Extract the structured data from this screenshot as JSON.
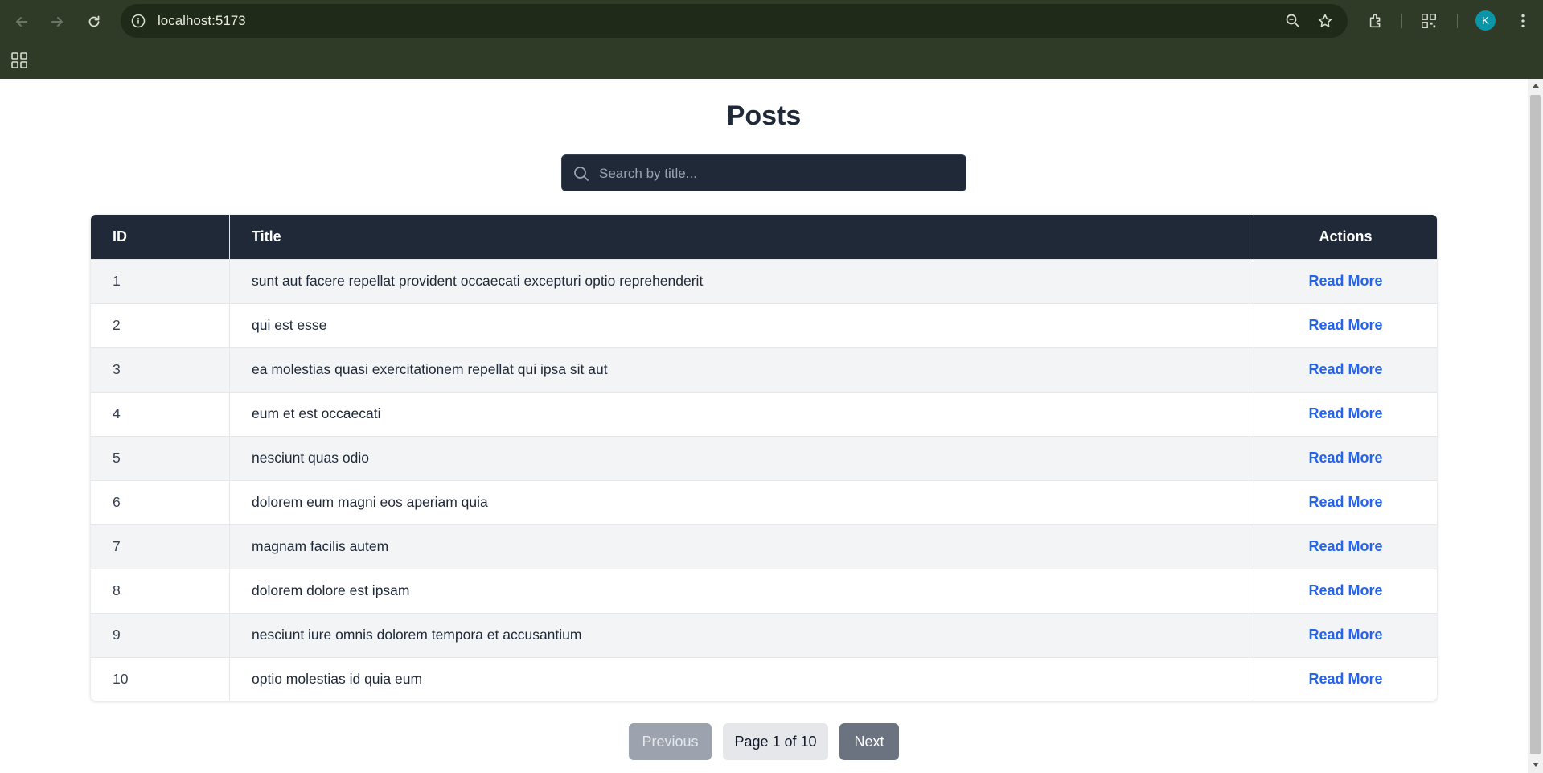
{
  "browser": {
    "url": "localhost:5173",
    "profile_initial": "K",
    "icons": [
      "back-icon",
      "forward-icon",
      "reload-icon",
      "site-info-icon",
      "zoom-icon",
      "star-icon",
      "extensions-icon",
      "qr-code-icon",
      "menu-icon",
      "apps-icon"
    ]
  },
  "page": {
    "title": "Posts",
    "search": {
      "placeholder": "Search by title...",
      "value": ""
    },
    "table": {
      "headers": {
        "id": "ID",
        "title": "Title",
        "actions": "Actions"
      },
      "rows": [
        {
          "id": "1",
          "title": "sunt aut facere repellat provident occaecati excepturi optio reprehenderit",
          "action": "Read More"
        },
        {
          "id": "2",
          "title": "qui est esse",
          "action": "Read More"
        },
        {
          "id": "3",
          "title": "ea molestias quasi exercitationem repellat qui ipsa sit aut",
          "action": "Read More"
        },
        {
          "id": "4",
          "title": "eum et est occaecati",
          "action": "Read More"
        },
        {
          "id": "5",
          "title": "nesciunt quas odio",
          "action": "Read More"
        },
        {
          "id": "6",
          "title": "dolorem eum magni eos aperiam quia",
          "action": "Read More"
        },
        {
          "id": "7",
          "title": "magnam facilis autem",
          "action": "Read More"
        },
        {
          "id": "8",
          "title": "dolorem dolore est ipsam",
          "action": "Read More"
        },
        {
          "id": "9",
          "title": "nesciunt iure omnis dolorem tempora et accusantium",
          "action": "Read More"
        },
        {
          "id": "10",
          "title": "optio molestias id quia eum",
          "action": "Read More"
        }
      ]
    },
    "pagination": {
      "previous": "Previous",
      "indicator": "Page 1 of 10",
      "next": "Next"
    }
  },
  "colors": {
    "chrome": "#2f3a27",
    "header_bg": "#1f2937",
    "link": "#2563eb",
    "avatar": "#0b95a8"
  }
}
